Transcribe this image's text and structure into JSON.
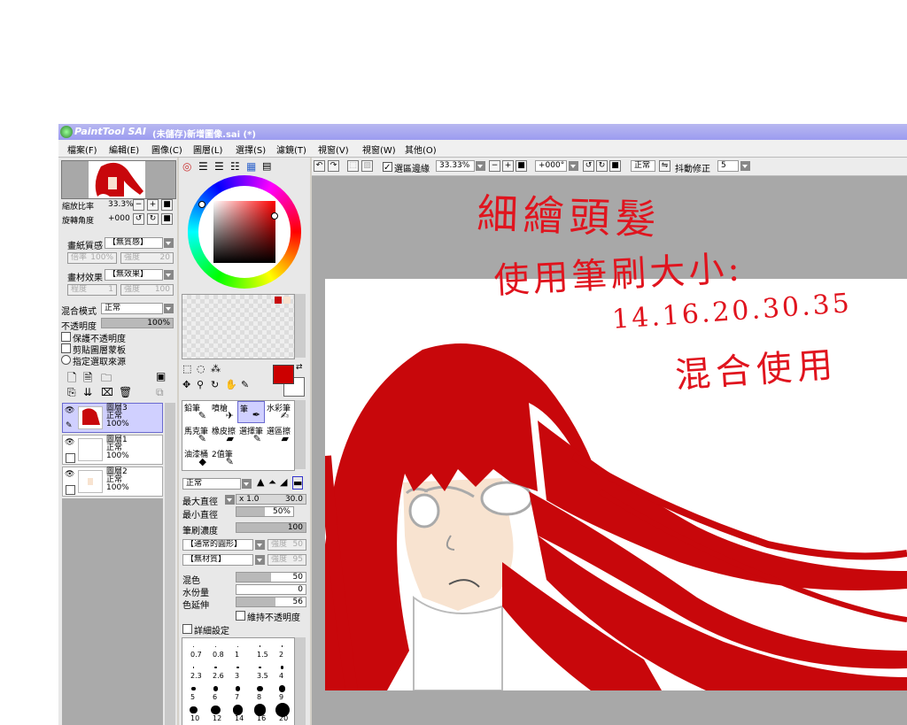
{
  "title": "(未儲存)新增圖像.sai (*)",
  "logo": "PaintTool SAI",
  "menu": [
    "檔案(F)",
    "編輯(E)",
    "圖像(C)",
    "圖層(L)",
    "選擇(S)",
    "濾鏡(T)",
    "視窗(V)",
    "視窗(W)",
    "其他(O)"
  ],
  "navigator": {
    "zoom_label": "縮放比率",
    "zoom_value": "33.3%",
    "rotate_label": "旋轉角度",
    "rotate_value": "+000"
  },
  "paper": {
    "texture_label": "畫紙質感",
    "texture_value": "【無質感】",
    "scale_label": "倍率",
    "scale_value": "100%",
    "strength_label": "強度",
    "strength_value": "20",
    "effect_label": "畫材效果",
    "effect_value": "【無效果】",
    "degree_label": "程度",
    "degree_value": "1",
    "strength2_label": "強度",
    "strength2_value": "100"
  },
  "layer_props": {
    "blend_label": "混合模式",
    "blend_value": "正常",
    "opacity_label": "不透明度",
    "opacity_value": "100%",
    "opacity": 1.0,
    "protect_opacity": "保護不透明度",
    "clip_group": "剪貼圖層蒙板",
    "selection_source": "指定選取來源"
  },
  "layers": [
    {
      "name": "圖層3",
      "mode": "正常",
      "opacity": "100%",
      "selected": true
    },
    {
      "name": "圖層1",
      "mode": "正常",
      "opacity": "100%",
      "selected": false
    },
    {
      "name": "圖層2",
      "mode": "正常",
      "opacity": "100%",
      "selected": false
    }
  ],
  "tools": [
    {
      "name": "鉛筆",
      "icon": "pencil-icon",
      "glyph": "✎"
    },
    {
      "name": "噴槍",
      "icon": "airbrush-icon",
      "glyph": "✈"
    },
    {
      "name": "筆",
      "icon": "pen-icon",
      "glyph": "✒"
    },
    {
      "name": "水彩筆",
      "icon": "watercolor-icon",
      "glyph": "✍"
    },
    {
      "name": "馬克筆",
      "icon": "marker-icon",
      "glyph": "✎"
    },
    {
      "name": "橡皮擦",
      "icon": "eraser-icon",
      "glyph": "▰"
    },
    {
      "name": "選擇筆",
      "icon": "select-pen-icon",
      "glyph": "✎"
    },
    {
      "name": "選區擦",
      "icon": "select-eraser-icon",
      "glyph": "▰"
    },
    {
      "name": "油漆桶",
      "icon": "bucket-icon",
      "glyph": "◆"
    },
    {
      "name": "2值筆",
      "icon": "binary-pen-icon",
      "glyph": "✎"
    }
  ],
  "brush": {
    "mode_value": "正常",
    "max_size_label": "最大直徑",
    "max_size_mult": "x 1.0",
    "max_size_value": "30.0",
    "min_size_label": "最小直徑",
    "min_size_value": "50%",
    "min_size": 0.5,
    "density_label": "筆刷濃度",
    "density_value": "100",
    "density": 1.0,
    "shape_value": "【通常的圓形】",
    "shape_strength_label": "強度",
    "shape_strength_value": "50",
    "texture_value": "【無材質】",
    "texture_strength_label": "強度",
    "texture_strength_value": "95",
    "blend_label": "混色",
    "blend_value": "50",
    "blend": 0.5,
    "water_label": "水份量",
    "water_value": "0",
    "water": 0.0,
    "persistence_label": "色延伸",
    "persistence_value": "56",
    "persistence": 0.56,
    "keep_opacity": "維持不透明度",
    "advanced": "詳細設定",
    "sizes_row1": [
      "0.7",
      "0.8",
      "1",
      "1.5",
      "2"
    ],
    "sizes_row2": [
      "2.3",
      "2.6",
      "3",
      "3.5",
      "4"
    ],
    "sizes_row3": [
      "5",
      "6",
      "7",
      "8",
      "9"
    ],
    "sizes_row4": [
      "10",
      "12",
      "14",
      "16",
      "20"
    ]
  },
  "toolbar": {
    "selection_edge": "選區邊緣",
    "zoom_value": "33.33%",
    "angle_value": "+000°",
    "mode_value": "正常",
    "stabilizer_label": "抖動修正",
    "stabilizer_value": "5"
  },
  "colors": {
    "primary": "#cc0000",
    "secondary": "#ffffff",
    "hair": "#c8070b",
    "skin": "#f8e3d0",
    "title_bar": "#a0a0f0"
  },
  "annotations": {
    "line1": "細繪頭髮",
    "line2": "使用筆刷大小:",
    "line3": "14.16.20.30.35",
    "line4": "混合使用"
  }
}
